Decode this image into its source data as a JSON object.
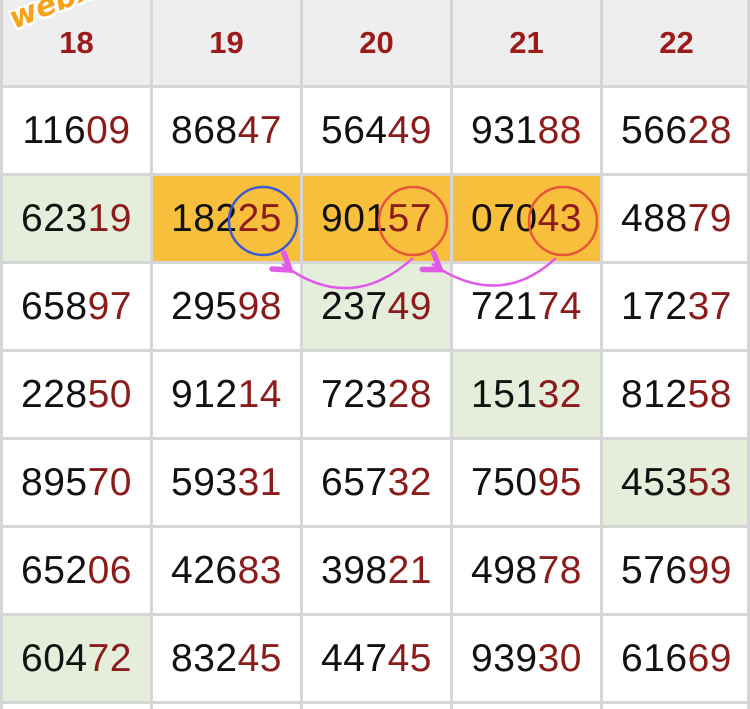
{
  "columns": [
    "18",
    "19",
    "20",
    "21",
    "22"
  ],
  "rows": [
    [
      "11609",
      "86847",
      "56449",
      "93188",
      "56628"
    ],
    [
      "62319",
      "18225",
      "90157",
      "07043",
      "48879"
    ],
    [
      "65897",
      "29598",
      "23749",
      "72174",
      "17237"
    ],
    [
      "22850",
      "91214",
      "72328",
      "15132",
      "81258"
    ],
    [
      "89570",
      "59331",
      "65732",
      "75095",
      "45353"
    ],
    [
      "65206",
      "42683",
      "39821",
      "49878",
      "57699"
    ],
    [
      "60472",
      "83245",
      "44745",
      "93930",
      "61669"
    ]
  ],
  "highlights": {
    "green": [
      [
        1,
        0
      ],
      [
        2,
        2
      ],
      [
        3,
        3
      ],
      [
        4,
        4
      ],
      [
        6,
        0
      ]
    ],
    "gold": [
      [
        1,
        1
      ],
      [
        1,
        2
      ],
      [
        1,
        3
      ]
    ]
  },
  "circles": [
    {
      "row": 1,
      "col": 1,
      "color": "#3b5bd6"
    },
    {
      "row": 1,
      "col": 2,
      "color": "#e8563a"
    },
    {
      "row": 1,
      "col": 3,
      "color": "#e8563a"
    }
  ],
  "arrows_color": "#e05ae8",
  "watermark": "webxoso.net",
  "colors": {
    "number_head": "#111111",
    "number_tail": "#8c1c1c",
    "header_text": "#9b1b1b",
    "header_bg": "#eeeeee",
    "green_bg": "#e4eedb",
    "gold_bg": "#f8bf3c"
  }
}
